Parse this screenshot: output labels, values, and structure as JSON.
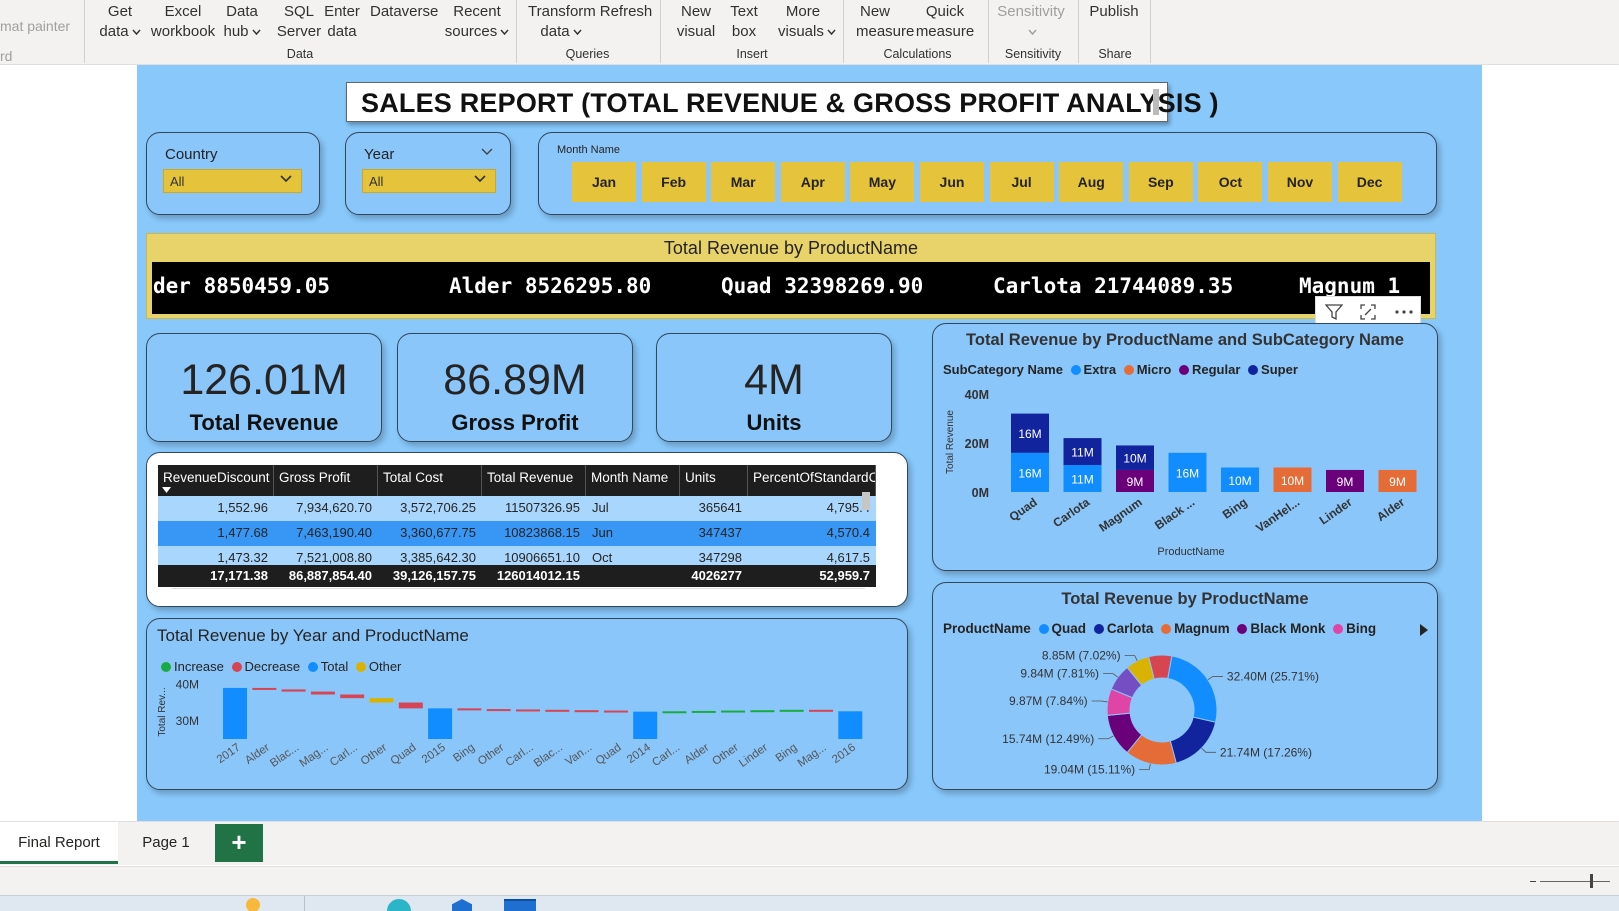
{
  "ribbon": {
    "left_fragments": [
      "mat painter",
      "rd"
    ],
    "items": [
      {
        "line1": "Get",
        "line2": "data",
        "chev": true
      },
      {
        "line1": "Excel",
        "line2": "workbook",
        "chev": false
      },
      {
        "line1": "Data",
        "line2": "hub",
        "chev": true
      },
      {
        "line1": "SQL",
        "line2": "Server",
        "chev": false
      },
      {
        "line1": "Enter",
        "line2": "data",
        "chev": false
      },
      {
        "line1": "Dataverse",
        "line2": "",
        "chev": false
      },
      {
        "line1": "Recent",
        "line2": "sources",
        "chev": true
      },
      {
        "line1": "Transform",
        "line2": "data",
        "chev": true
      },
      {
        "line1": "Refresh",
        "line2": "",
        "chev": false
      },
      {
        "line1": "New",
        "line2": "visual",
        "chev": false
      },
      {
        "line1": "Text",
        "line2": "box",
        "chev": false
      },
      {
        "line1": "More",
        "line2": "visuals",
        "chev": true
      },
      {
        "line1": "New",
        "line2": "measure",
        "chev": false
      },
      {
        "line1": "Quick",
        "line2": "measure",
        "chev": false
      },
      {
        "line1": "Sensitivity",
        "line2": "",
        "chev": true
      },
      {
        "line1": "Publish",
        "line2": "",
        "chev": false
      }
    ],
    "groups": [
      "Data",
      "Queries",
      "Insert",
      "Calculations",
      "Sensitivity",
      "Share"
    ]
  },
  "report": {
    "title": "SALES REPORT (TOTAL REVENUE & GROSS PROFIT ANALYSIS )",
    "slicers": {
      "country": {
        "label": "Country",
        "value": "All"
      },
      "year": {
        "label": "Year",
        "value": "All"
      },
      "month": {
        "label": "Month Name",
        "options": [
          "Jan",
          "Feb",
          "Mar",
          "Apr",
          "May",
          "Jun",
          "Jul",
          "Aug",
          "Sep",
          "Oct",
          "Nov",
          "Dec"
        ]
      }
    },
    "ticker": {
      "title": "Total Revenue by ProductName",
      "items": [
        "der 8850459.05",
        "Alder 8526295.80",
        "Quad 32398269.90",
        "Carlota 21744089.35",
        "Magnum 1"
      ]
    },
    "kpis": [
      {
        "value": "126.01M",
        "label": "Total Revenue"
      },
      {
        "value": "86.89M",
        "label": "Gross Profit"
      },
      {
        "value": "4M",
        "label": "Units"
      }
    ],
    "table": {
      "columns": [
        "RevenueDiscount",
        "Gross Profit",
        "Total Cost",
        "Total Revenue",
        "Month Name",
        "Units",
        "PercentOfStandardCo"
      ],
      "rows": [
        [
          "1,552.96",
          "7,934,620.70",
          "3,572,706.25",
          "11507326.95",
          "Jul",
          "365641",
          "4,795.4"
        ],
        [
          "1,477.68",
          "7,463,190.40",
          "3,360,677.75",
          "10823868.15",
          "Jun",
          "347437",
          "4,570.4"
        ],
        [
          "1,473.32",
          "7,521,008.80",
          "3,385,642.30",
          "10906651.10",
          "Oct",
          "347298",
          "4,617.5"
        ]
      ],
      "totals": [
        "17,171.38",
        "86,887,854.40",
        "39,126,157.75",
        "126014012.15",
        "",
        "4026277",
        "52,959.7"
      ]
    },
    "stacked_chart": {
      "title": "Total Revenue by ProductName and SubCategory Name",
      "legend_title": "SubCategory Name",
      "legend": [
        "Extra",
        "Micro",
        "Regular",
        "Super"
      ],
      "ylabel": "Total Revenue",
      "xlabel": "ProductName",
      "yticks": [
        "40M",
        "20M",
        "0M"
      ]
    },
    "waterfall_chart": {
      "title": "Total Revenue by Year and ProductName",
      "legend": [
        "Increase",
        "Decrease",
        "Total",
        "Other"
      ],
      "ylabel": "Total Rev...",
      "yticks": [
        "40M",
        "30M"
      ]
    },
    "donut_chart": {
      "title": "Total Revenue by ProductName",
      "legend_title": "ProductName",
      "legend": [
        "Quad",
        "Carlota",
        "Magnum",
        "Black Monk",
        "Bing"
      ]
    }
  },
  "chart_data": [
    {
      "type": "bar",
      "title": "Total Revenue by ProductName and SubCategory Name",
      "xlabel": "ProductName",
      "ylabel": "Total Revenue",
      "ylim": [
        0,
        40
      ],
      "categories": [
        "Quad",
        "Carlota",
        "Magnum",
        "Black ...",
        "Bing",
        "VanHel...",
        "Linder",
        "Alder"
      ],
      "series": [
        {
          "name": "Extra",
          "values": [
            16,
            11,
            0,
            16,
            10,
            0,
            0,
            0
          ],
          "labels": [
            "16M",
            "11M",
            "",
            "16M",
            "10M",
            "",
            "",
            ""
          ]
        },
        {
          "name": "Micro",
          "values": [
            0,
            0,
            0,
            0,
            0,
            10,
            0,
            9
          ],
          "labels": [
            "",
            "",
            "",
            "",
            "",
            "10M",
            "",
            "9M"
          ]
        },
        {
          "name": "Regular",
          "values": [
            0,
            0,
            9,
            0,
            0,
            0,
            9,
            0
          ],
          "labels": [
            "",
            "",
            "9M",
            "",
            "",
            "",
            "9M",
            ""
          ]
        },
        {
          "name": "Super",
          "values": [
            16,
            11,
            10,
            0,
            0,
            0,
            0,
            0
          ],
          "labels": [
            "16M",
            "11M",
            "10M",
            "",
            "",
            "",
            "",
            ""
          ]
        }
      ],
      "colors": {
        "Extra": "#118dff",
        "Micro": "#e66c37",
        "Regular": "#6b007b",
        "Super": "#12239e"
      }
    },
    {
      "type": "bar",
      "title": "Total Revenue by Year and ProductName",
      "ylabel": "Total Rev...",
      "ylim": [
        25,
        42
      ],
      "categories": [
        "2017",
        "Alder",
        "Blac...",
        "Mag...",
        "Carl...",
        "Other",
        "Quad",
        "2015",
        "Bing",
        "Other",
        "Carl...",
        "Blac...",
        "Van...",
        "Quad",
        "2014",
        "Carl...",
        "Alder",
        "Other",
        "Linder",
        "Bing",
        "Mag...",
        "2016"
      ],
      "waterfall": [
        {
          "kind": "Total",
          "start": 0,
          "end": 39
        },
        {
          "kind": "Decrease",
          "start": 39,
          "end": 38.6
        },
        {
          "kind": "Decrease",
          "start": 38.6,
          "end": 38
        },
        {
          "kind": "Decrease",
          "start": 38,
          "end": 37.2
        },
        {
          "kind": "Decrease",
          "start": 37.2,
          "end": 36.2
        },
        {
          "kind": "Other",
          "start": 36.2,
          "end": 35
        },
        {
          "kind": "Decrease",
          "start": 35,
          "end": 33.4
        },
        {
          "kind": "Total",
          "start": 0,
          "end": 33.4
        },
        {
          "kind": "Decrease",
          "start": 33.4,
          "end": 33.2
        },
        {
          "kind": "Decrease",
          "start": 33.2,
          "end": 33.1
        },
        {
          "kind": "Decrease",
          "start": 33.1,
          "end": 33
        },
        {
          "kind": "Decrease",
          "start": 33,
          "end": 32.9
        },
        {
          "kind": "Decrease",
          "start": 32.9,
          "end": 32.8
        },
        {
          "kind": "Decrease",
          "start": 32.8,
          "end": 32.5
        },
        {
          "kind": "Total",
          "start": 0,
          "end": 32.5
        },
        {
          "kind": "Increase",
          "start": 32.5,
          "end": 32.6
        },
        {
          "kind": "Increase",
          "start": 32.6,
          "end": 32.7
        },
        {
          "kind": "Increase",
          "start": 32.7,
          "end": 32.8
        },
        {
          "kind": "Increase",
          "start": 32.8,
          "end": 32.9
        },
        {
          "kind": "Increase",
          "start": 32.9,
          "end": 33
        },
        {
          "kind": "Decrease",
          "start": 33,
          "end": 32.6
        },
        {
          "kind": "Total",
          "start": 0,
          "end": 32.6
        }
      ],
      "colors": {
        "Increase": "#1aab40",
        "Decrease": "#d64554",
        "Total": "#118dff",
        "Other": "#d9b300"
      }
    },
    {
      "type": "pie",
      "title": "Total Revenue by ProductName",
      "slices": [
        {
          "value": 32.4,
          "label": "32.40M (25.71%)",
          "color": "#118dff"
        },
        {
          "value": 21.74,
          "label": "21.74M (17.26%)",
          "color": "#12239e"
        },
        {
          "value": 19.04,
          "label": "19.04M (15.11%)",
          "color": "#e66c37"
        },
        {
          "value": 15.74,
          "label": "15.74M (12.49%)",
          "color": "#6b007b"
        },
        {
          "value": 9.87,
          "label": "9.87M (7.84%)",
          "color": "#e044a7"
        },
        {
          "value": 9.84,
          "label": "9.84M (7.81%)",
          "color": "#744ec2"
        },
        {
          "value": 8.85,
          "label": "8.85M (7.02%)",
          "color": "#d9b300"
        },
        {
          "value": 8.53,
          "label": "",
          "color": "#d64550"
        }
      ]
    }
  ],
  "pages": {
    "tabs": [
      "Final Report",
      "Page 1"
    ],
    "add_label": "+"
  },
  "colors": {
    "canvas": "#88c8fb",
    "accent_yellow": "#e5c33a",
    "dark": "#1e1e1e",
    "tab_accent": "#217346"
  }
}
